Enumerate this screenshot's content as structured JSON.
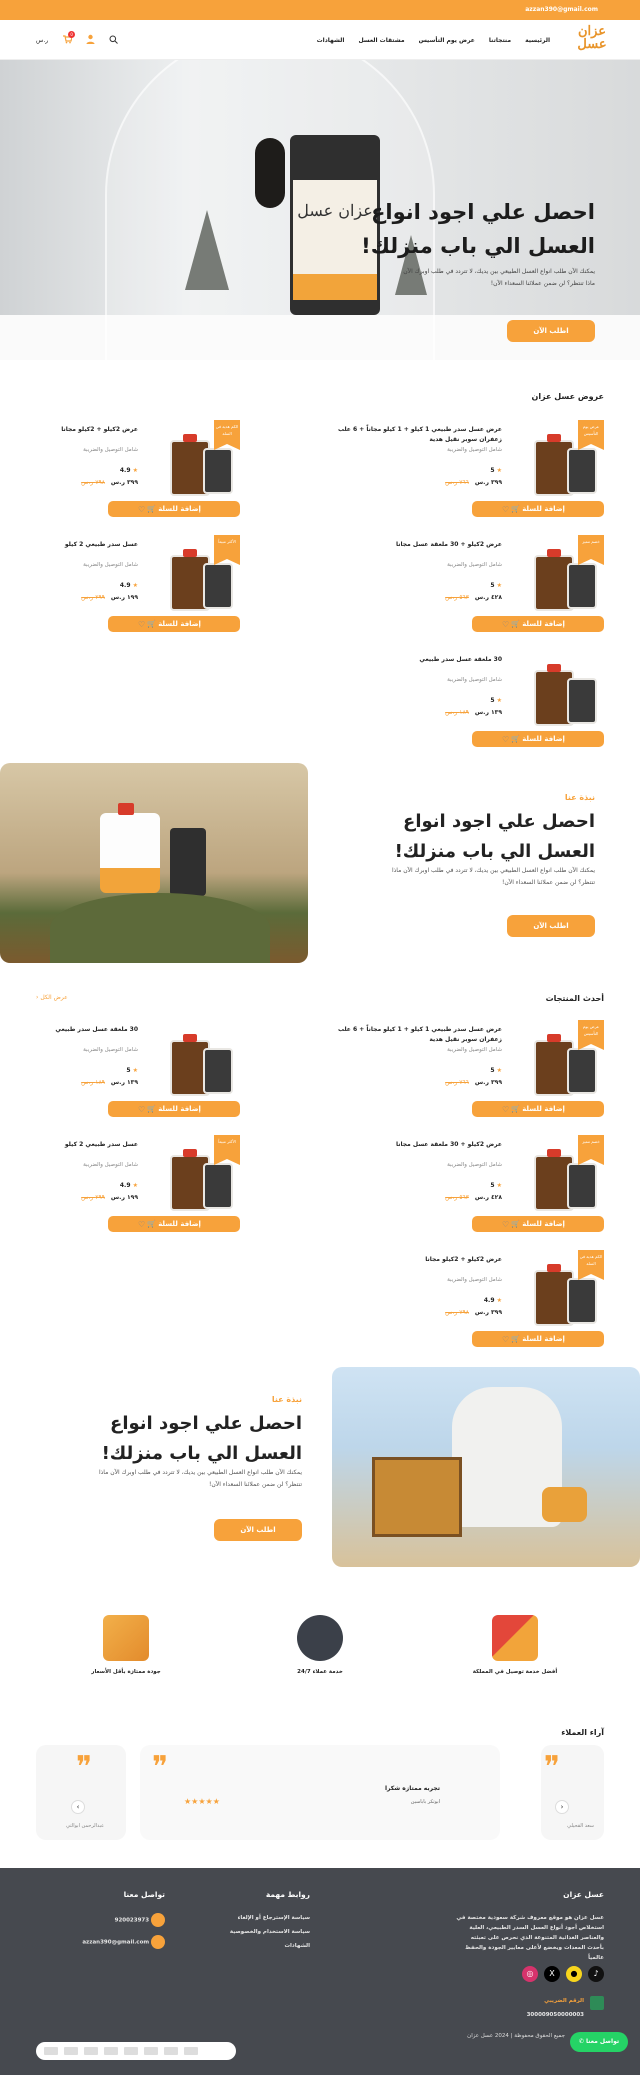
{
  "topbar": {
    "email": "azzan390@gmail.com"
  },
  "header": {
    "logo_text": "عزان عسل",
    "nav": [
      "الرئيسية",
      "منتجاتنا",
      "عرض يوم التأسيس",
      "مشتقات العسل",
      "الشهادات"
    ],
    "cart_count": "0",
    "currency": "ر.س"
  },
  "hero": {
    "title": "احصل علي اجود انواع العسل الي باب منزلك!",
    "subtitle": "يمكنك الآن طلب انواع العسل الطبيعي بين يديك، لا تتردد في طلب اوبرك الآن ماذا تنتظر؟ لن ضمن عملائنا السعداء الآن!",
    "button": "اطلب الآن",
    "jar_label": "عزان عسل"
  },
  "offers": {
    "title": "عروض عسل عزان",
    "products": [
      {
        "name": "عرض عسل سدر طبيعي 1 كيلو + 1 كيلو مجاناً + 6 علب زعفران سوبر نقيل هدية",
        "ship": "شامل التوصيل والضريبة",
        "rating": "5",
        "price": "٣٩٩ ر.س",
        "old": "٧٦٦ ر.س",
        "tag": "عرض يوم التأسيس"
      },
      {
        "name": "عرض 2كيلو + 2كيلو مجانا",
        "ship": "شامل التوصيل والضريبة",
        "rating": "4.9",
        "price": "٣٩٩ ر.س",
        "old": "٧٩٨ ر.س",
        "tag": "الكم هدية في السلة"
      },
      {
        "name": "عرض 2كيلو + 30 ملعقة عسل مجانا",
        "ship": "شامل التوصيل والضريبة",
        "rating": "5",
        "price": "٤٢٨ ر.س",
        "old": "٥٦٣ ر.س",
        "tag": "خصم مميز"
      },
      {
        "name": "عسل سدر طبيعي 2 كيلو",
        "ship": "شامل التوصيل والضريبة",
        "rating": "4.9",
        "price": "١٩٩ ر.س",
        "old": "٢٩٩ ر.س",
        "tag": "الأكثر مبيعاً"
      },
      {
        "name": "30 ملعقة عسل سدر طبيعي",
        "ship": "شامل التوصيل والضريبة",
        "rating": "5",
        "price": "١٣٩ ر.س",
        "old": "١٨٩ ر.س",
        "tag": ""
      }
    ],
    "add_label": "إضافة للسلة"
  },
  "about1": {
    "small": "نبذة عنا",
    "title": "احصل علي اجود انواع العسل الي باب منزلك!",
    "text": "يمكنك الآن طلب انواع العسل الطبيعي بين يديك، لا تتردد في طلب اوبرك الآن ماذا تنتظر؟ لن ضمن عملائنا السعداء الآن!",
    "button": "اطلب الآن"
  },
  "latest": {
    "title": "أحدث المنتجات",
    "view_all": "عرض الكل",
    "products": [
      {
        "name": "عرض عسل سدر طبيعي 1 كيلو + 1 كيلو مجاناً + 6 علب زعفران سوبر نقيل هدية",
        "ship": "شامل التوصيل والضريبة",
        "rating": "5",
        "price": "٣٩٩ ر.س",
        "old": "٧٦٦ ر.س",
        "tag": "عرض يوم التأسيس"
      },
      {
        "name": "30 ملعقة عسل سدر طبيعي",
        "ship": "شامل التوصيل والضريبة",
        "rating": "5",
        "price": "١٣٩ ر.س",
        "old": "١٨٩ ر.س",
        "tag": ""
      },
      {
        "name": "عرض 2كيلو + 30 ملعقة عسل مجانا",
        "ship": "شامل التوصيل والضريبة",
        "rating": "5",
        "price": "٤٢٨ ر.س",
        "old": "٥٦٣ ر.س",
        "tag": "خصم مميز"
      },
      {
        "name": "عسل سدر طبيعي 2 كيلو",
        "ship": "شامل التوصيل والضريبة",
        "rating": "4.9",
        "price": "١٩٩ ر.س",
        "old": "٢٩٩ ر.س",
        "tag": "الأكثر مبيعاً"
      },
      {
        "name": "عرض 2كيلو + 2كيلو مجانا",
        "ship": "شامل التوصيل والضريبة",
        "rating": "4.9",
        "price": "٣٩٩ ر.س",
        "old": "٧٩٨ ر.س",
        "tag": "الكم هدية في السلة"
      }
    ]
  },
  "about2": {
    "small": "نبذة عنا",
    "title": "احصل علي اجود انواع العسل الي باب منزلك!",
    "text": "يمكنك الآن طلب انواع العسل الطبيعي بين يديك، لا تتردد في طلب اوبرك الآن ماذا تنتظر؟ لن ضمن عملائنا السعداء الآن!",
    "button": "اطلب الآن"
  },
  "features": [
    "أفضل خدمة توصيل في المملكة",
    "خدمة عملاء 24/7",
    "جودة ممتازة بأقل الأسعار"
  ],
  "reviews": {
    "title": "آراء العملاء",
    "main": {
      "text": "تجربه ممتازه شكرا",
      "name": "ابوتكر باباسين",
      "stars": "★★★★★"
    },
    "left_name": "عبدالرحمن ابوالتي",
    "right_name": "سعد القحيلي"
  },
  "footer": {
    "about_title": "عسل عزان",
    "about_text": "عسل عزان هو موقع معروف شركة سعودية مختصة في استخلاص أجود أنواع العسل السدر الطبيعي، العلية والعناصر الغذائية المتنوعة الذي نحرص على تعبئته بأحدث المعدات ويخضع لأعلى معايير الجودة والحفظ عالمياً",
    "tax_label": "الرقم الضريبي",
    "tax_number": "300009050000003",
    "links_title": "روابط مهمة",
    "links": [
      "سياسة الإسترجاع أو الإلغاء",
      "سياسة الاستخدام والخصوصية",
      "الشهادات"
    ],
    "contact_title": "تواصل معنا",
    "phone": "920023973",
    "email": "azzan390@gmail.com",
    "copyright": "جميع الحقوق محفوظة | 2024 عسل عزان",
    "whatsapp": "تواصل معنا"
  }
}
